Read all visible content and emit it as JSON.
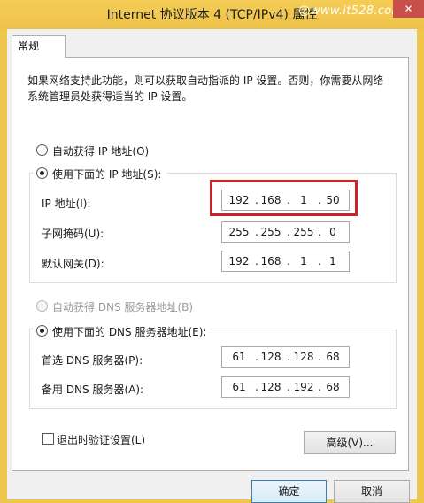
{
  "window": {
    "title": "Internet 协议版本 4 (TCP/IPv4) 属性",
    "watermark": "www.it528.com",
    "close_glyph": "✕"
  },
  "tabs": [
    {
      "label": "常规"
    }
  ],
  "description": "如果网络支持此功能，则可以获取自动指派的 IP 设置。否则，你需要从网络系统管理员处获得适当的 IP 设置。",
  "ip_section": {
    "auto_label": "自动获得 IP 地址(O)",
    "manual_label": "使用下面的 IP 地址(S):",
    "manual_selected": true,
    "fields": [
      {
        "label": "IP 地址(I):",
        "octets": [
          "192",
          "168",
          "1",
          "50"
        ]
      },
      {
        "label": "子网掩码(U):",
        "octets": [
          "255",
          "255",
          "255",
          "0"
        ]
      },
      {
        "label": "默认网关(D):",
        "octets": [
          "192",
          "168",
          "1",
          "1"
        ]
      }
    ]
  },
  "dns_section": {
    "auto_label": "自动获得 DNS 服务器地址(B)",
    "manual_label": "使用下面的 DNS 服务器地址(E):",
    "manual_selected": true,
    "fields": [
      {
        "label": "首选 DNS 服务器(P):",
        "octets": [
          "61",
          "128",
          "128",
          "68"
        ]
      },
      {
        "label": "备用 DNS 服务器(A):",
        "octets": [
          "61",
          "128",
          "192",
          "68"
        ]
      }
    ]
  },
  "validate_on_exit": {
    "label": "退出时验证设置(L)",
    "checked": false
  },
  "buttons": {
    "advanced": "高级(V)...",
    "ok": "确定",
    "cancel": "取消"
  },
  "colors": {
    "titlebar": "#f0c74d",
    "highlight": "#c8252a"
  }
}
